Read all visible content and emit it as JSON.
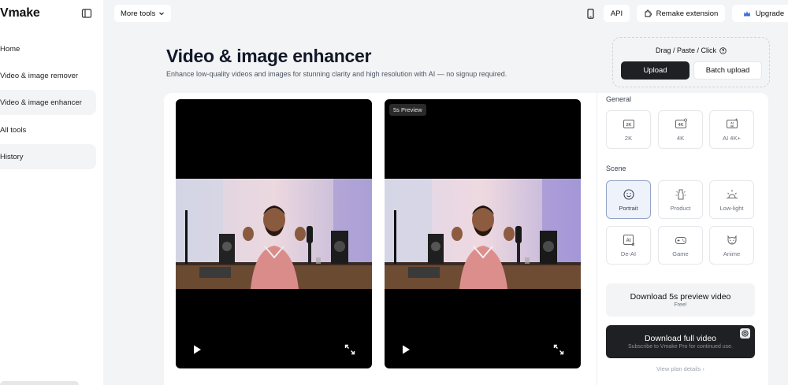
{
  "sidebar": {
    "logo": "Vmake",
    "items": [
      {
        "label": "Home"
      },
      {
        "label": "Video & image remover"
      },
      {
        "label": "Video & image enhancer"
      },
      {
        "label": "All tools"
      },
      {
        "label": "History"
      }
    ]
  },
  "topbar": {
    "more_tools": "More tools",
    "api": "API",
    "remake": "Remake extension",
    "upgrade": "Upgrade"
  },
  "header": {
    "title": "Video & image enhancer",
    "subtitle": "Enhance low-quality videos and images for stunning clarity and high resolution with AI — no signup required."
  },
  "upload": {
    "hint": "Drag / Paste / Click",
    "upload_label": "Upload",
    "batch_label": "Batch upload"
  },
  "preview": {
    "badge": "5s Preview"
  },
  "options": {
    "general_label": "General",
    "general": [
      {
        "label": "2K",
        "icon": "2k-icon"
      },
      {
        "label": "4K",
        "icon": "4k-icon"
      },
      {
        "label": "AI 4K+",
        "icon": "ai-4k-plus-icon"
      }
    ],
    "scene_label": "Scene",
    "scene": [
      {
        "label": "Portrait",
        "icon": "smiley-face-icon",
        "selected": true
      },
      {
        "label": "Product",
        "icon": "product-icon"
      },
      {
        "label": "Low-light",
        "icon": "sunrise-icon"
      },
      {
        "label": "De-AI",
        "icon": "de-ai-icon"
      },
      {
        "label": "Game",
        "icon": "gamepad-icon"
      },
      {
        "label": "Anime",
        "icon": "anime-face-icon"
      }
    ]
  },
  "download": {
    "preview_title": "Download 5s preview video",
    "preview_sub": "Free!",
    "full_title": "Download full video",
    "full_sub": "Subscribe to Vmake Pro for continued use.",
    "plan_link": "View plan details ›"
  },
  "colors": {
    "accent_dark": "#1f2023",
    "selected_border": "#93a3c4",
    "upgrade_icon": "#3b6fd8"
  }
}
